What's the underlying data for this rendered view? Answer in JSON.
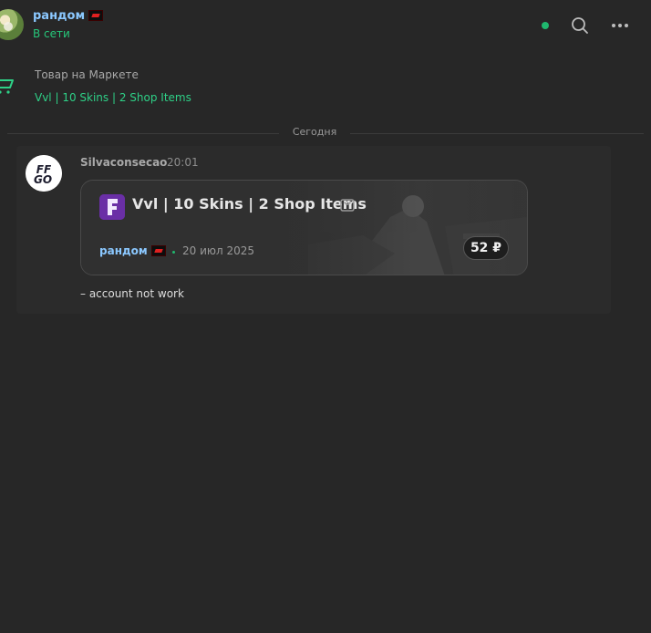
{
  "header": {
    "user_name": "рандом",
    "status": "В сети"
  },
  "market": {
    "label": "Товар на Маркете",
    "product_title": "Vvl | 10 Skins | 2 Shop Items"
  },
  "divider": {
    "label": "Сегодня"
  },
  "message": {
    "author": "Silvaconsecao",
    "time": "20:01",
    "avatar_text": "FF GO",
    "card": {
      "title": "Vvl | 10 Skins | 2 Shop Items",
      "game_icon": "fortnite-icon",
      "seller": "рандом",
      "date": "20 июл 2025",
      "price": "52 ₽"
    },
    "text": "– account not work"
  },
  "colors": {
    "background": "#272727",
    "accent_green": "#27c77a",
    "username_blue": "#8bc8ff",
    "game_purple": "#6a2fa6"
  }
}
